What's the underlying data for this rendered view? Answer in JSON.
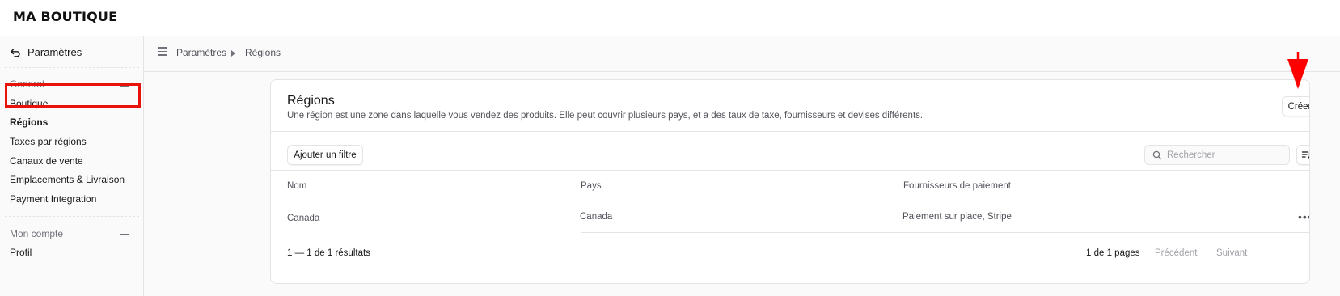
{
  "brand": "MA BOUTIQUE",
  "sidebar": {
    "back_label": "Paramètres",
    "sections": [
      {
        "title": "General",
        "items": [
          "Boutique",
          "Régions",
          "Taxes par régions",
          "Canaux de vente",
          "Emplacements & Livraison",
          "Payment Integration"
        ]
      },
      {
        "title": "Mon compte",
        "items": [
          "Profil"
        ]
      }
    ],
    "active_item": "Régions"
  },
  "breadcrumb": {
    "items": [
      "Paramètres",
      "Régions"
    ]
  },
  "card": {
    "title": "Régions",
    "description": "Une région est une zone dans laquelle vous vendez des produits. Elle peut couvrir plusieurs pays, et a des taux de taxe, fournisseurs et devises différents.",
    "create_label": "Créer",
    "filter_label": "Ajouter un filtre",
    "search_placeholder": "Rechercher"
  },
  "table": {
    "columns": [
      "Nom",
      "Pays",
      "Fournisseurs de paiement"
    ],
    "rows": [
      {
        "name": "Canada",
        "country": "Canada",
        "providers": "Paiement sur place, Stripe"
      }
    ]
  },
  "pagination": {
    "results": "1 — 1 de 1 résultats",
    "pages": "1 de 1 pages",
    "prev_label": "Précédent",
    "next_label": "Suivant"
  },
  "colors": {
    "highlight": "#e8120b",
    "arrow": "#ff0000"
  }
}
